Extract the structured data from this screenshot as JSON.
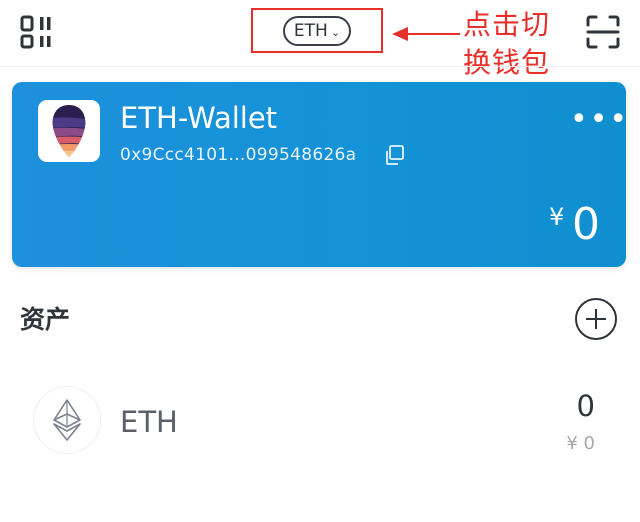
{
  "header": {
    "network_label": "ETH",
    "annotation_text": "点击切换钱包",
    "annotation_color": "#e8302a"
  },
  "wallet": {
    "name": "ETH-Wallet",
    "address": "0x9Ccc4101...099548626a",
    "balance_currency": "¥",
    "balance_value": "0",
    "card_color": "#1a8fd8"
  },
  "assets": {
    "heading": "资产",
    "items": [
      {
        "symbol": "ETH",
        "amount": "0",
        "fiat_value": "¥ 0",
        "icon": "ethereum-icon"
      }
    ]
  },
  "icons": {
    "menu": "grid-menu-icon",
    "scan": "scan-icon",
    "copy": "copy-icon",
    "more": "more-icon",
    "add": "plus-circle-icon"
  }
}
